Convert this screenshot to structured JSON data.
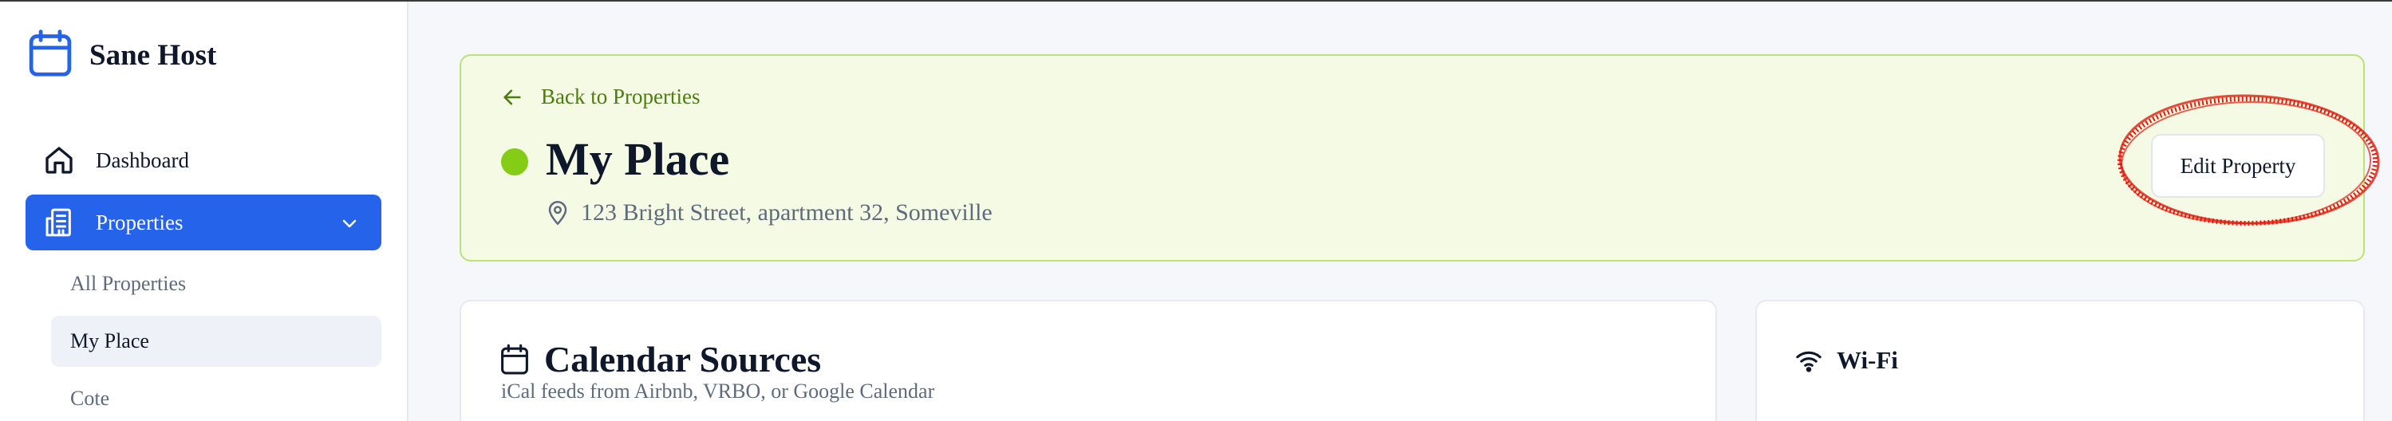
{
  "app": {
    "name": "Sane Host",
    "icon": "calendar-icon"
  },
  "sidebar": {
    "items": [
      {
        "label": "Dashboard",
        "icon": "home-icon",
        "active": false
      },
      {
        "label": "Properties",
        "icon": "building-icon",
        "active": true,
        "expanded": true
      }
    ],
    "subitems": [
      {
        "label": "All Properties",
        "active": false
      },
      {
        "label": "My Place",
        "active": true
      },
      {
        "label": "Cote",
        "active": false
      }
    ]
  },
  "header": {
    "back_label": "Back to Properties",
    "title": "My Place",
    "address": "123 Bright Street, apartment 32, Someville",
    "edit_label": "Edit Property",
    "status_color": "#84cc16"
  },
  "calendar_card": {
    "title": "Calendar Sources",
    "subtitle": "iCal feeds from Airbnb, VRBO, or Google Calendar",
    "icon": "calendar-icon"
  },
  "wifi_card": {
    "title": "Wi-Fi",
    "icon": "wifi-icon"
  },
  "colors": {
    "accent": "#2563eb",
    "header_bg": "#f5fae4",
    "header_border": "#bce27a",
    "annotation": "#e11d0e"
  }
}
